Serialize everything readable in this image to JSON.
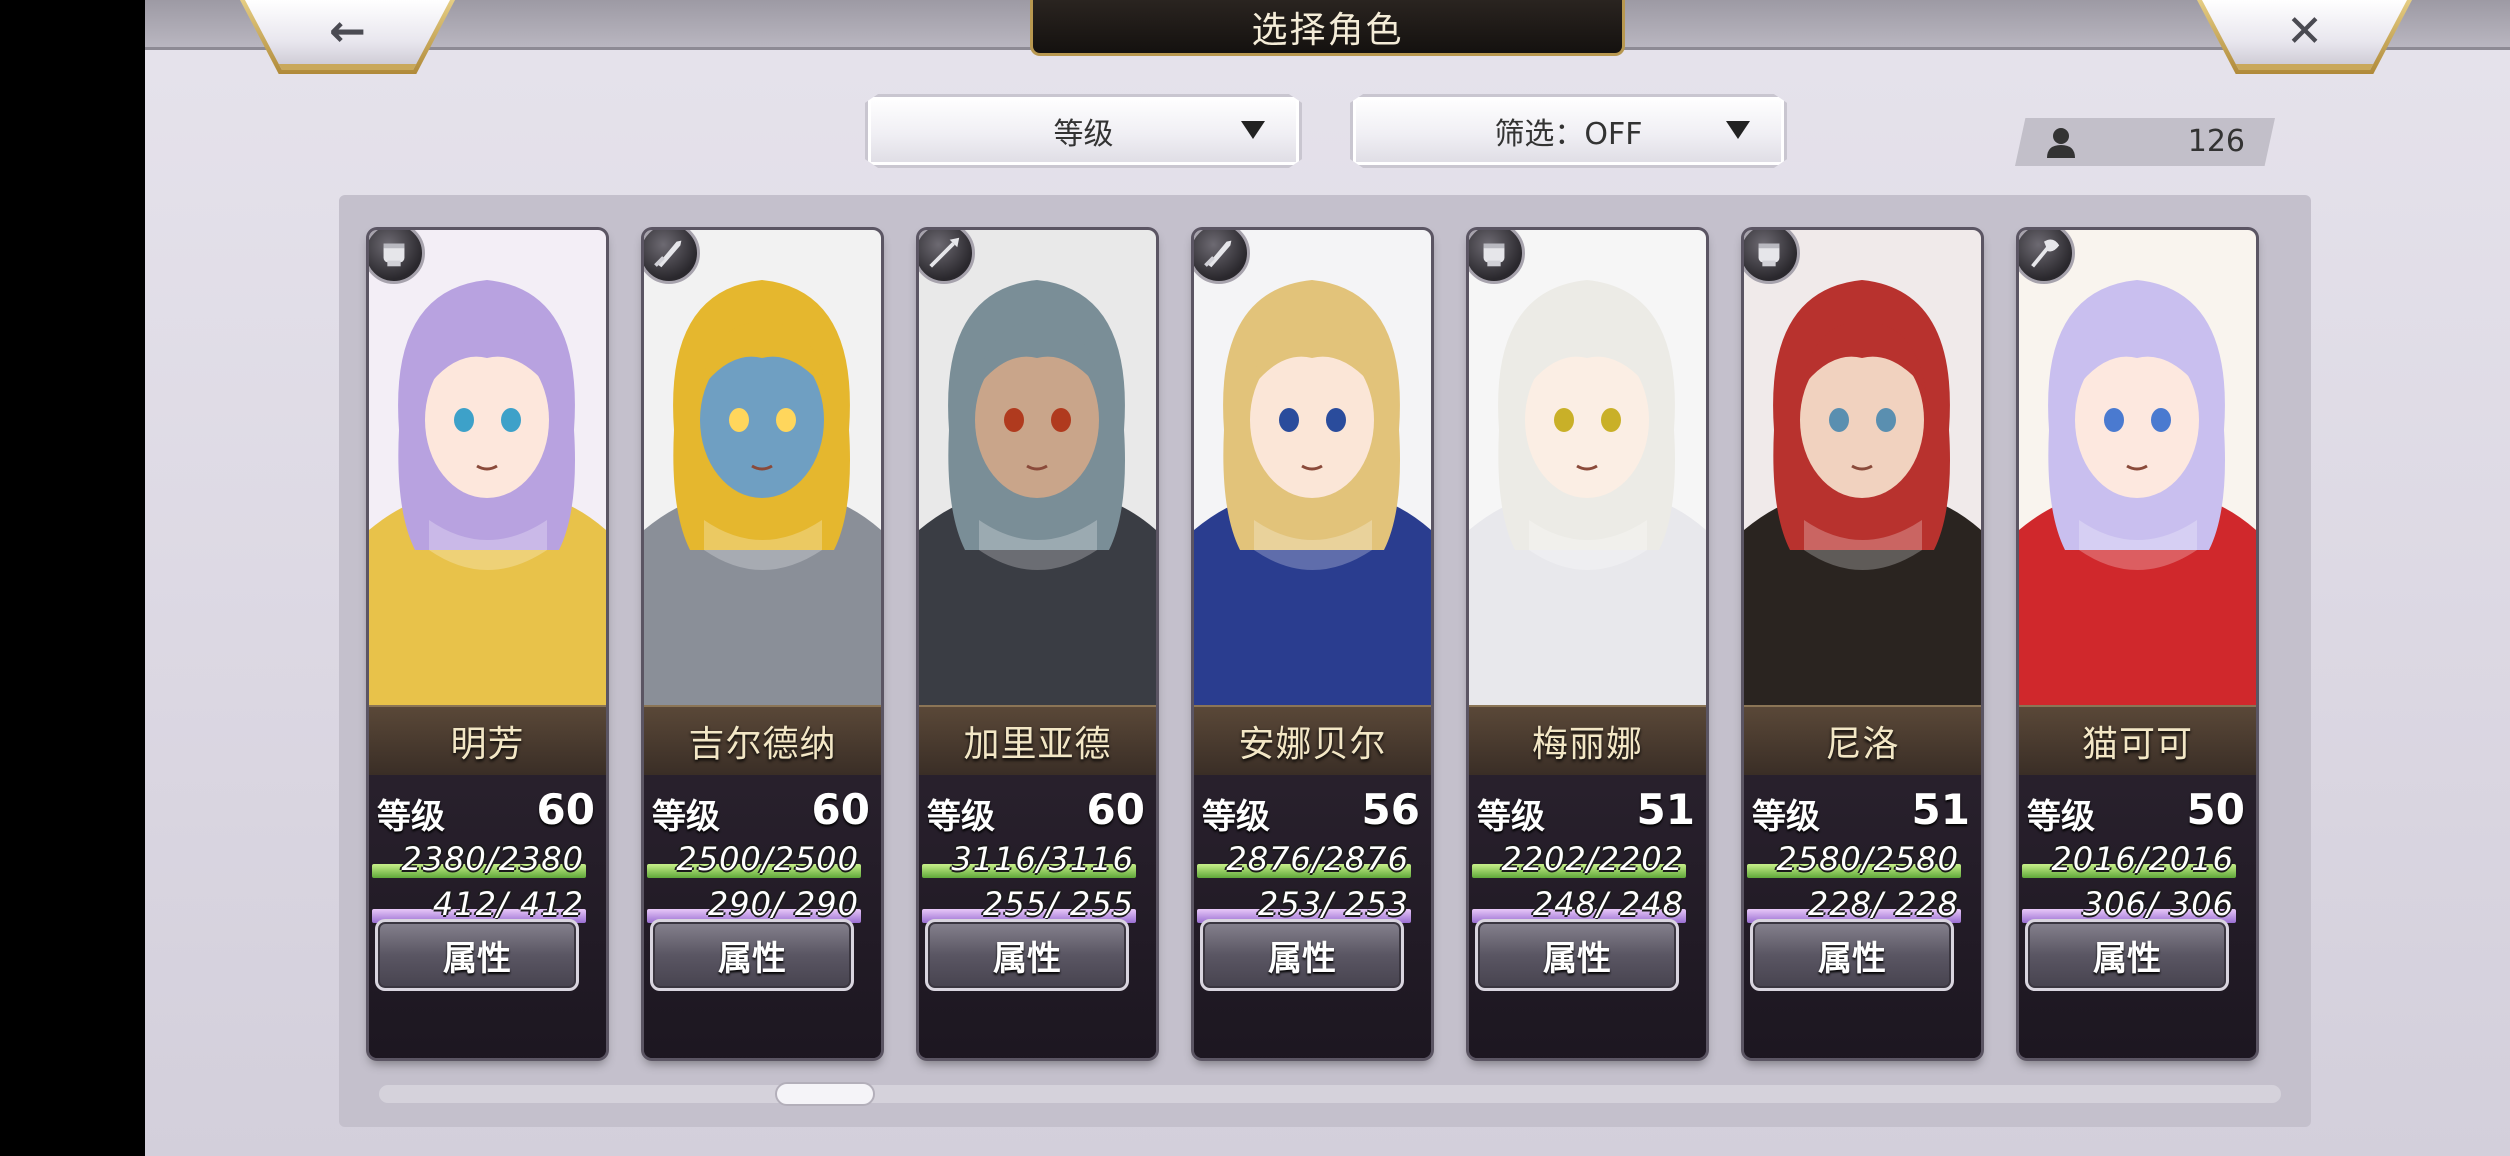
{
  "header": {
    "title": "选择角色",
    "back_icon": "←",
    "close_icon": "✕"
  },
  "sort": {
    "label": "等级"
  },
  "filter": {
    "label": "筛选：OFF"
  },
  "roster_count": "126",
  "colors": {
    "hp_bar": "#5fa83a",
    "mp_bar": "#9a6fd2",
    "name_bar": "#3a2e26",
    "gold_trim": "#c9a85a"
  },
  "scroll_position": 0.22,
  "characters": [
    {
      "name": "明芳",
      "level_label": "等级",
      "level": "60",
      "hp": "2380/2380",
      "mp": " 412/ 412",
      "button": "属性",
      "class_icon": "fist-icon"
    },
    {
      "name": "吉尔德纳",
      "level_label": "等级",
      "level": "60",
      "hp": "2500/2500",
      "mp": " 290/ 290",
      "button": "属性",
      "class_icon": "sword-icon"
    },
    {
      "name": "加里亚德",
      "level_label": "等级",
      "level": "60",
      "hp": "3116/3116",
      "mp": " 255/ 255",
      "button": "属性",
      "class_icon": "spear-icon"
    },
    {
      "name": "安娜贝尔",
      "level_label": "等级",
      "level": "56",
      "hp": "2876/2876",
      "mp": " 253/ 253",
      "button": "属性",
      "class_icon": "sword-icon"
    },
    {
      "name": "梅丽娜",
      "level_label": "等级",
      "level": "51",
      "hp": "2202/2202",
      "mp": " 248/ 248",
      "button": "属性",
      "class_icon": "fist-icon"
    },
    {
      "name": "尼洛",
      "level_label": "等级",
      "level": "51",
      "hp": "2580/2580",
      "mp": " 228/ 228",
      "button": "属性",
      "class_icon": "fist-icon"
    },
    {
      "name": "猫可可",
      "level_label": "等级",
      "level": "50",
      "hp": "2016/2016",
      "mp": " 306/ 306",
      "button": "属性",
      "class_icon": "axe-icon"
    }
  ]
}
